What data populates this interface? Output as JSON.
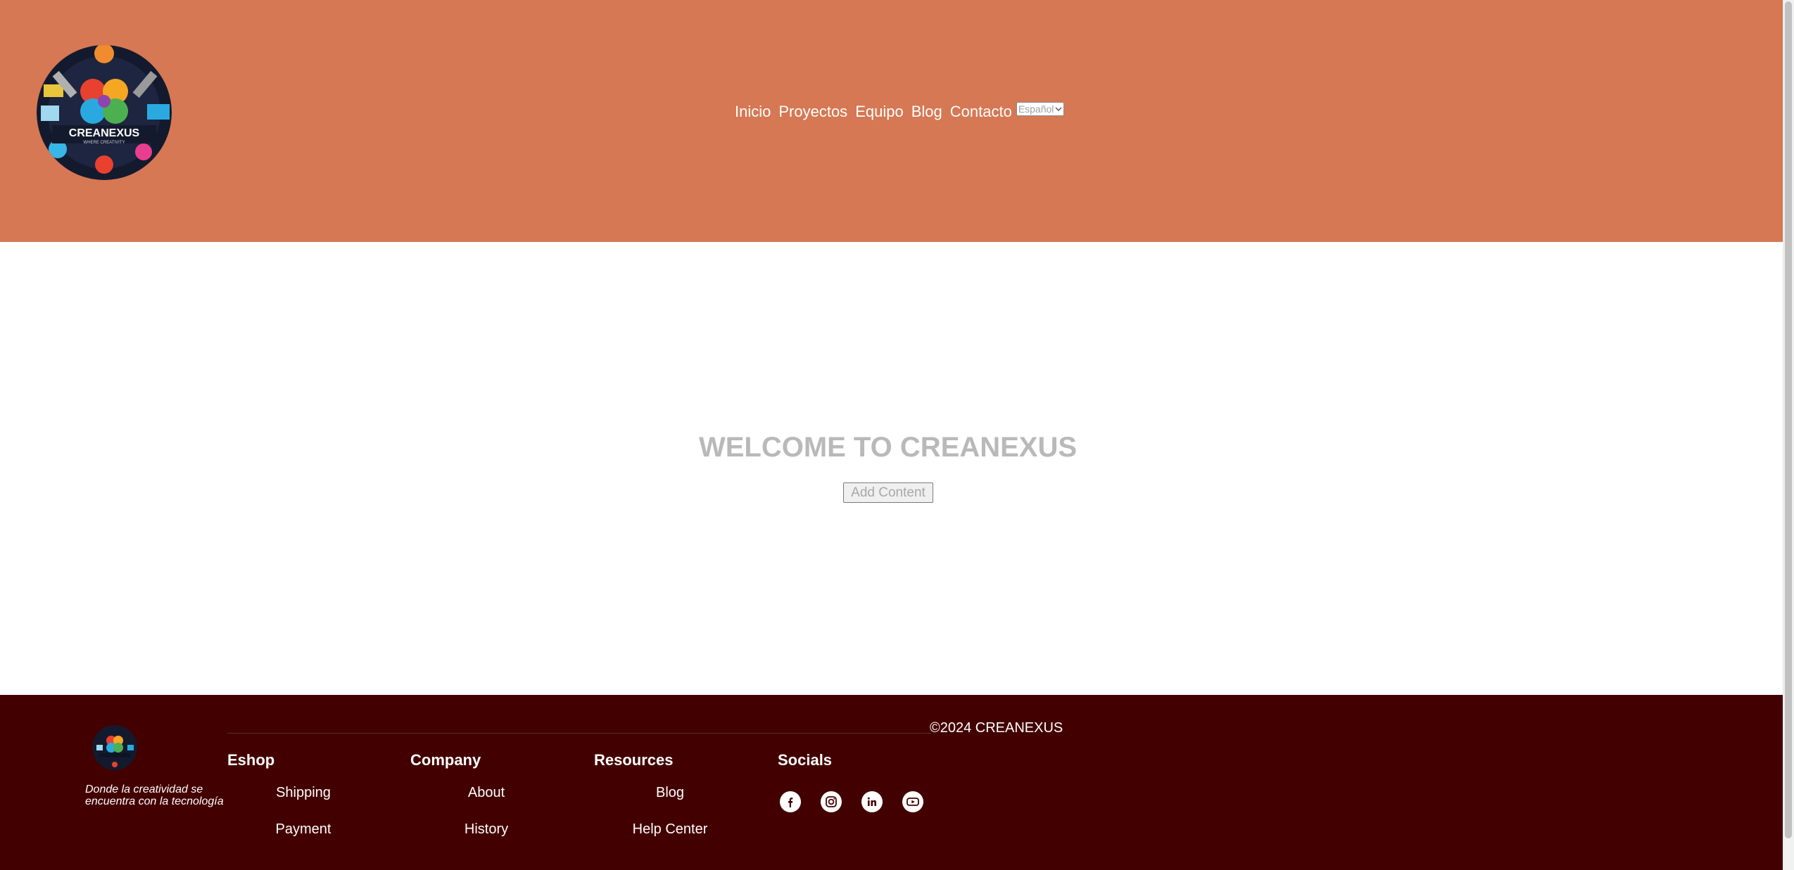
{
  "header": {
    "logo_icon": "creanexus-logo-icon",
    "nav": [
      "Inicio",
      "Proyectos",
      "Equipo",
      "Blog",
      "Contacto"
    ],
    "language": "Español",
    "background": "#d57853"
  },
  "main": {
    "title": "WELCOME TO CREANEXUS",
    "add_button": "Add Content"
  },
  "footer": {
    "background": "#430000",
    "logo_icon": "creanexus-logo-icon",
    "tagline_line1": "Donde la creatividad se",
    "tagline_line2": "encuentra con la tecnología",
    "copyright": "©2024 CREANEXUS",
    "columns": [
      {
        "title": "Eshop",
        "links": [
          "Shipping",
          "Payment"
        ]
      },
      {
        "title": "Company",
        "links": [
          "About",
          "History"
        ]
      },
      {
        "title": "Resources",
        "links": [
          "Blog",
          "Help Center"
        ]
      },
      {
        "title": "Socials",
        "icons": [
          "facebook-icon",
          "instagram-icon",
          "linkedin-icon",
          "youtube-icon"
        ]
      }
    ]
  }
}
